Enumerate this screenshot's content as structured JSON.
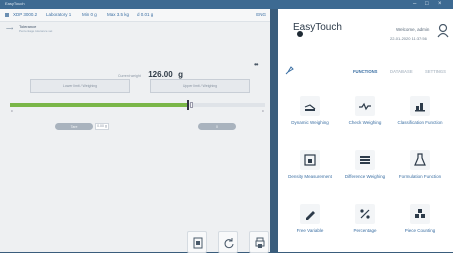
{
  "window": {
    "title": "EasyTouch",
    "controls": [
      "–",
      "□",
      "×"
    ]
  },
  "statusbar": {
    "items": [
      "XDP 3000.2",
      "Laboratory 1",
      "Min 0 g",
      "Max 3.5 kg",
      "d 0.01 g"
    ],
    "lang": "ENG"
  },
  "tolerance": {
    "title": "Tolerance",
    "subtitle": "Percentage tolerance set"
  },
  "weight": {
    "label": "Current weight",
    "value": "126.00",
    "unit": "g"
  },
  "more_label": "••",
  "tare_box_left": "Lower limit / Weighing",
  "tare_box_right": "Upper limit / Weighing",
  "progress": {
    "value_percent": 70,
    "axis_min": "0",
    "axis_max": "0"
  },
  "pill_left": "Tare",
  "pill_left_tag": "0.00 g",
  "pill_right": "0",
  "brand": "EasyTouch",
  "welcome": "Welcome, admin",
  "datetime": "22-01-2020 11:37:56",
  "tabs": [
    {
      "label": "FUNCTIONS",
      "active": true
    },
    {
      "label": "DATABASE",
      "active": false
    },
    {
      "label": "SETTINGS",
      "active": false
    }
  ],
  "functions": [
    {
      "label": "Dynamic Weighing",
      "icon": "dynamic-weighing-icon"
    },
    {
      "label": "Check Weighing",
      "icon": "check-weighing-icon"
    },
    {
      "label": "Classification Function",
      "icon": "classification-icon"
    },
    {
      "label": "Density Measurement",
      "icon": "density-icon"
    },
    {
      "label": "Difference Weighing",
      "icon": "difference-weighing-icon"
    },
    {
      "label": "Formulation Function",
      "icon": "formulation-icon"
    },
    {
      "label": "Free Variable",
      "icon": "free-variable-icon"
    },
    {
      "label": "Percentage",
      "icon": "percentage-icon"
    },
    {
      "label": "Piece Counting",
      "icon": "piece-counting-icon"
    }
  ]
}
